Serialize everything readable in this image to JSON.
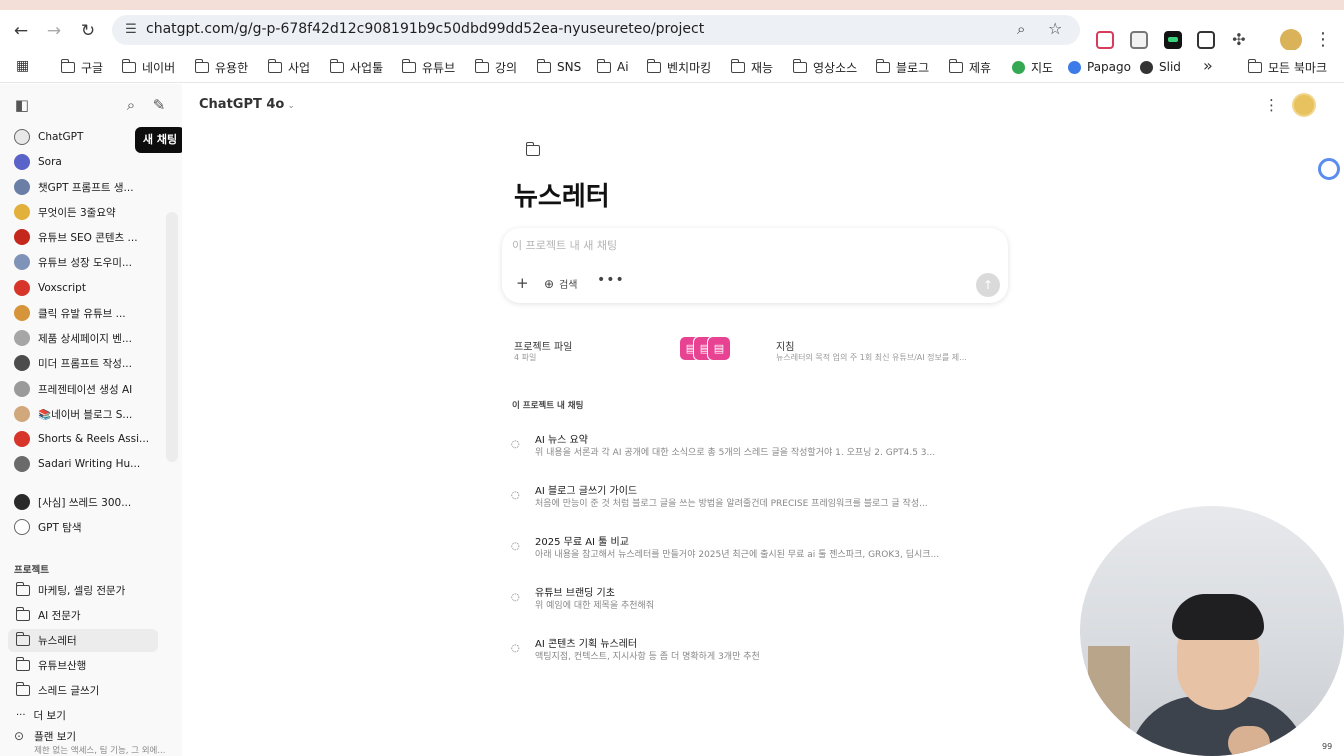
{
  "browser": {
    "url": "chatgpt.com/g/g-p-678f42d12c908191b9c50dbd99dd52ea-nyuseureteo/project",
    "bookmarks": [
      {
        "label": "구글",
        "icon": "folder-icon"
      },
      {
        "label": "네이버",
        "icon": "folder-icon"
      },
      {
        "label": "유용한",
        "icon": "folder-icon"
      },
      {
        "label": "사업",
        "icon": "folder-icon"
      },
      {
        "label": "사업툴",
        "icon": "folder-icon"
      },
      {
        "label": "유튜브",
        "icon": "folder-icon"
      },
      {
        "label": "강의",
        "icon": "folder-icon"
      },
      {
        "label": "SNS",
        "icon": "folder-icon"
      },
      {
        "label": "Ai",
        "icon": "folder-icon"
      },
      {
        "label": "벤치마킹",
        "icon": "folder-icon"
      },
      {
        "label": "재능",
        "icon": "folder-icon"
      },
      {
        "label": "영상소스",
        "icon": "folder-icon"
      },
      {
        "label": "블로그",
        "icon": "folder-icon"
      },
      {
        "label": "제휴",
        "icon": "folder-icon"
      },
      {
        "label": "지도",
        "icon": "map-icon"
      },
      {
        "label": "Papago",
        "icon": "papago-icon"
      },
      {
        "label": "Slid",
        "icon": "slid-icon"
      }
    ],
    "bookmarks_overflow": "»",
    "all_bookmarks": "모든 북마크"
  },
  "sidebar": {
    "tooltip": "새 채팅",
    "gpts": [
      {
        "label": "ChatGPT",
        "color": "#e8e8e8"
      },
      {
        "label": "Sora",
        "color": "#5a63c8"
      },
      {
        "label": "챗GPT 프롬프트 생...",
        "color": "#6b7fa6"
      },
      {
        "label": "무엇이든 3줄요약",
        "color": "#e2b13c"
      },
      {
        "label": "유튜브 SEO 콘텐츠 ...",
        "color": "#c4281d"
      },
      {
        "label": "유튜브 성장 도우미...",
        "color": "#7f93b8"
      },
      {
        "label": "Voxscript",
        "color": "#d8352a"
      },
      {
        "label": "클릭 유발 유튜브 ...",
        "color": "#d6953a"
      },
      {
        "label": "제품 상세페이지 벤...",
        "color": "#a6a6a6"
      },
      {
        "label": "미더 프롬프트 작성...",
        "color": "#4c4c4c"
      },
      {
        "label": "프레젠테이션 생성 AI",
        "color": "#9a9a9a"
      },
      {
        "label": "📚네이버 블로그 S...",
        "color": "#d1a77c"
      },
      {
        "label": "Shorts & Reels Assi...",
        "color": "#d8352a"
      },
      {
        "label": "Sadari Writing Hu...",
        "color": "#6a6a6a"
      },
      {
        "label": "[사심] 쓰레드 300...",
        "color": "#2a2a2a"
      },
      {
        "label": "GPT 탐색",
        "color": "#ffffff"
      }
    ],
    "projects_header": "프로젝트",
    "projects": [
      {
        "label": "마케팅, 셀링 전문가"
      },
      {
        "label": "AI 전문가"
      },
      {
        "label": "뉴스레터"
      },
      {
        "label": "유튜브산행"
      },
      {
        "label": "스레드 글쓰기"
      },
      {
        "label": "더 보기"
      }
    ],
    "plan": {
      "title": "플랜 보기",
      "subtitle": "제한 없는 액세스, 팀 기능, 그 외에..."
    }
  },
  "main": {
    "model": "ChatGPT 4o",
    "project_title": "뉴스레터",
    "composer_placeholder": "이 프로젝트 내 새 채팅",
    "search_label": "검색",
    "cards": {
      "files_title": "프로젝트 파일",
      "files_count": "4 파일",
      "instructions_title": "지침",
      "instructions_text": "뉴스레터의 목적 업의 주 1회 최신 유튜브/AI 정보를 제..."
    },
    "chats_header": "이 프로젝트 내 채팅",
    "chats": [
      {
        "title": "AI 뉴스 요약",
        "preview": "위 내용을 서론과 각 AI 공개에 대한 소식으로 총 5개의 스레드 글을 작성할거야 1. 오프닝 2. GPT4.5 3..."
      },
      {
        "title": "AI 블로그 글쓰기 가이드",
        "preview": "처음에 만능이 준 것 처럼 블로그 글을 쓰는 방법을 알려줄건데 PRECISE 프레임워크를 블로그 글 작성..."
      },
      {
        "title": "2025 무료 AI 툴 비교",
        "preview": "아래 내용을 참고해서 뉴스레터를 만들거야 2025년 최근에 출시된 무료 ai 툴 젠스파크, GROK3, 딥시크..."
      },
      {
        "title": "유튜브 브랜딩 기초",
        "preview": "위 예임에 대한 제목을 추천해줘"
      },
      {
        "title": "AI 콘텐츠 기획 뉴스레터",
        "preview": "액팅지점, 컨텍스트, 지시사항 등 좀 더 명확하게 3개만 추천"
      }
    ]
  },
  "corner_text": "99"
}
